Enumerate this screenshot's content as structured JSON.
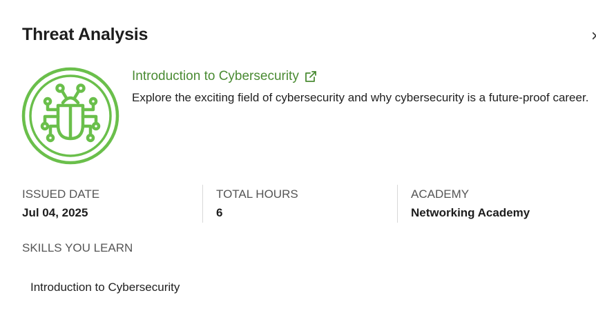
{
  "panel": {
    "title": "Threat Analysis",
    "close_glyph": "×"
  },
  "badge": {
    "icon": "bug-icon",
    "color": "#6abf4b"
  },
  "course": {
    "name": "Introduction to Cybersecurity",
    "link_icon": "external-link-icon",
    "link_color": "#4a8b33",
    "description": "Explore the exciting field of cybersecurity and why cybersecurity is a future-proof career."
  },
  "meta": {
    "issued_label": "ISSUED DATE",
    "issued_value": "Jul 04, 2025",
    "hours_label": "TOTAL HOURS",
    "hours_value": "6",
    "academy_label": "ACADEMY",
    "academy_value": "Networking Academy"
  },
  "skills": {
    "heading": "SKILLS YOU LEARN",
    "items": [
      "Introduction to Cybersecurity"
    ]
  }
}
